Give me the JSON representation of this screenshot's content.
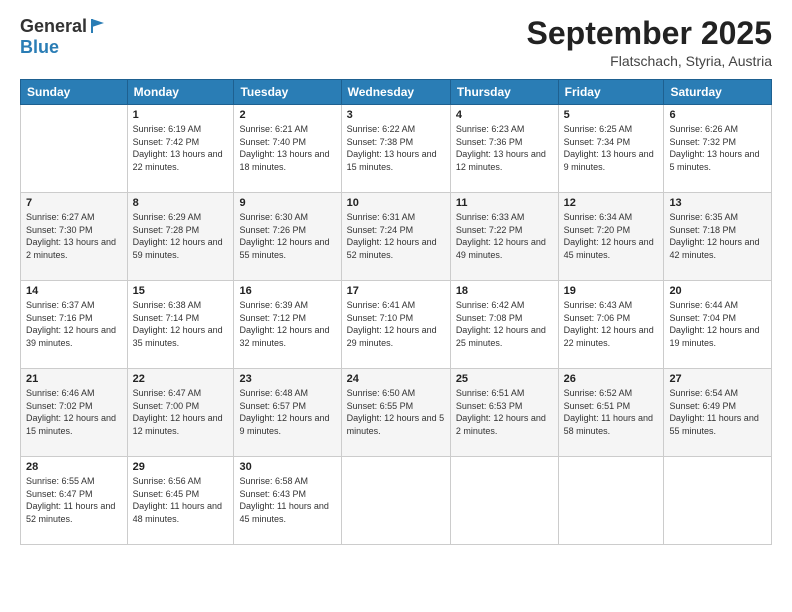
{
  "header": {
    "logo_general": "General",
    "logo_blue": "Blue",
    "title": "September 2025",
    "location": "Flatschach, Styria, Austria"
  },
  "days_of_week": [
    "Sunday",
    "Monday",
    "Tuesday",
    "Wednesday",
    "Thursday",
    "Friday",
    "Saturday"
  ],
  "weeks": [
    [
      {
        "day": "",
        "sunrise": "",
        "sunset": "",
        "daylight": ""
      },
      {
        "day": "1",
        "sunrise": "Sunrise: 6:19 AM",
        "sunset": "Sunset: 7:42 PM",
        "daylight": "Daylight: 13 hours and 22 minutes."
      },
      {
        "day": "2",
        "sunrise": "Sunrise: 6:21 AM",
        "sunset": "Sunset: 7:40 PM",
        "daylight": "Daylight: 13 hours and 18 minutes."
      },
      {
        "day": "3",
        "sunrise": "Sunrise: 6:22 AM",
        "sunset": "Sunset: 7:38 PM",
        "daylight": "Daylight: 13 hours and 15 minutes."
      },
      {
        "day": "4",
        "sunrise": "Sunrise: 6:23 AM",
        "sunset": "Sunset: 7:36 PM",
        "daylight": "Daylight: 13 hours and 12 minutes."
      },
      {
        "day": "5",
        "sunrise": "Sunrise: 6:25 AM",
        "sunset": "Sunset: 7:34 PM",
        "daylight": "Daylight: 13 hours and 9 minutes."
      },
      {
        "day": "6",
        "sunrise": "Sunrise: 6:26 AM",
        "sunset": "Sunset: 7:32 PM",
        "daylight": "Daylight: 13 hours and 5 minutes."
      }
    ],
    [
      {
        "day": "7",
        "sunrise": "Sunrise: 6:27 AM",
        "sunset": "Sunset: 7:30 PM",
        "daylight": "Daylight: 13 hours and 2 minutes."
      },
      {
        "day": "8",
        "sunrise": "Sunrise: 6:29 AM",
        "sunset": "Sunset: 7:28 PM",
        "daylight": "Daylight: 12 hours and 59 minutes."
      },
      {
        "day": "9",
        "sunrise": "Sunrise: 6:30 AM",
        "sunset": "Sunset: 7:26 PM",
        "daylight": "Daylight: 12 hours and 55 minutes."
      },
      {
        "day": "10",
        "sunrise": "Sunrise: 6:31 AM",
        "sunset": "Sunset: 7:24 PM",
        "daylight": "Daylight: 12 hours and 52 minutes."
      },
      {
        "day": "11",
        "sunrise": "Sunrise: 6:33 AM",
        "sunset": "Sunset: 7:22 PM",
        "daylight": "Daylight: 12 hours and 49 minutes."
      },
      {
        "day": "12",
        "sunrise": "Sunrise: 6:34 AM",
        "sunset": "Sunset: 7:20 PM",
        "daylight": "Daylight: 12 hours and 45 minutes."
      },
      {
        "day": "13",
        "sunrise": "Sunrise: 6:35 AM",
        "sunset": "Sunset: 7:18 PM",
        "daylight": "Daylight: 12 hours and 42 minutes."
      }
    ],
    [
      {
        "day": "14",
        "sunrise": "Sunrise: 6:37 AM",
        "sunset": "Sunset: 7:16 PM",
        "daylight": "Daylight: 12 hours and 39 minutes."
      },
      {
        "day": "15",
        "sunrise": "Sunrise: 6:38 AM",
        "sunset": "Sunset: 7:14 PM",
        "daylight": "Daylight: 12 hours and 35 minutes."
      },
      {
        "day": "16",
        "sunrise": "Sunrise: 6:39 AM",
        "sunset": "Sunset: 7:12 PM",
        "daylight": "Daylight: 12 hours and 32 minutes."
      },
      {
        "day": "17",
        "sunrise": "Sunrise: 6:41 AM",
        "sunset": "Sunset: 7:10 PM",
        "daylight": "Daylight: 12 hours and 29 minutes."
      },
      {
        "day": "18",
        "sunrise": "Sunrise: 6:42 AM",
        "sunset": "Sunset: 7:08 PM",
        "daylight": "Daylight: 12 hours and 25 minutes."
      },
      {
        "day": "19",
        "sunrise": "Sunrise: 6:43 AM",
        "sunset": "Sunset: 7:06 PM",
        "daylight": "Daylight: 12 hours and 22 minutes."
      },
      {
        "day": "20",
        "sunrise": "Sunrise: 6:44 AM",
        "sunset": "Sunset: 7:04 PM",
        "daylight": "Daylight: 12 hours and 19 minutes."
      }
    ],
    [
      {
        "day": "21",
        "sunrise": "Sunrise: 6:46 AM",
        "sunset": "Sunset: 7:02 PM",
        "daylight": "Daylight: 12 hours and 15 minutes."
      },
      {
        "day": "22",
        "sunrise": "Sunrise: 6:47 AM",
        "sunset": "Sunset: 7:00 PM",
        "daylight": "Daylight: 12 hours and 12 minutes."
      },
      {
        "day": "23",
        "sunrise": "Sunrise: 6:48 AM",
        "sunset": "Sunset: 6:57 PM",
        "daylight": "Daylight: 12 hours and 9 minutes."
      },
      {
        "day": "24",
        "sunrise": "Sunrise: 6:50 AM",
        "sunset": "Sunset: 6:55 PM",
        "daylight": "Daylight: 12 hours and 5 minutes."
      },
      {
        "day": "25",
        "sunrise": "Sunrise: 6:51 AM",
        "sunset": "Sunset: 6:53 PM",
        "daylight": "Daylight: 12 hours and 2 minutes."
      },
      {
        "day": "26",
        "sunrise": "Sunrise: 6:52 AM",
        "sunset": "Sunset: 6:51 PM",
        "daylight": "Daylight: 11 hours and 58 minutes."
      },
      {
        "day": "27",
        "sunrise": "Sunrise: 6:54 AM",
        "sunset": "Sunset: 6:49 PM",
        "daylight": "Daylight: 11 hours and 55 minutes."
      }
    ],
    [
      {
        "day": "28",
        "sunrise": "Sunrise: 6:55 AM",
        "sunset": "Sunset: 6:47 PM",
        "daylight": "Daylight: 11 hours and 52 minutes."
      },
      {
        "day": "29",
        "sunrise": "Sunrise: 6:56 AM",
        "sunset": "Sunset: 6:45 PM",
        "daylight": "Daylight: 11 hours and 48 minutes."
      },
      {
        "day": "30",
        "sunrise": "Sunrise: 6:58 AM",
        "sunset": "Sunset: 6:43 PM",
        "daylight": "Daylight: 11 hours and 45 minutes."
      },
      {
        "day": "",
        "sunrise": "",
        "sunset": "",
        "daylight": ""
      },
      {
        "day": "",
        "sunrise": "",
        "sunset": "",
        "daylight": ""
      },
      {
        "day": "",
        "sunrise": "",
        "sunset": "",
        "daylight": ""
      },
      {
        "day": "",
        "sunrise": "",
        "sunset": "",
        "daylight": ""
      }
    ]
  ]
}
